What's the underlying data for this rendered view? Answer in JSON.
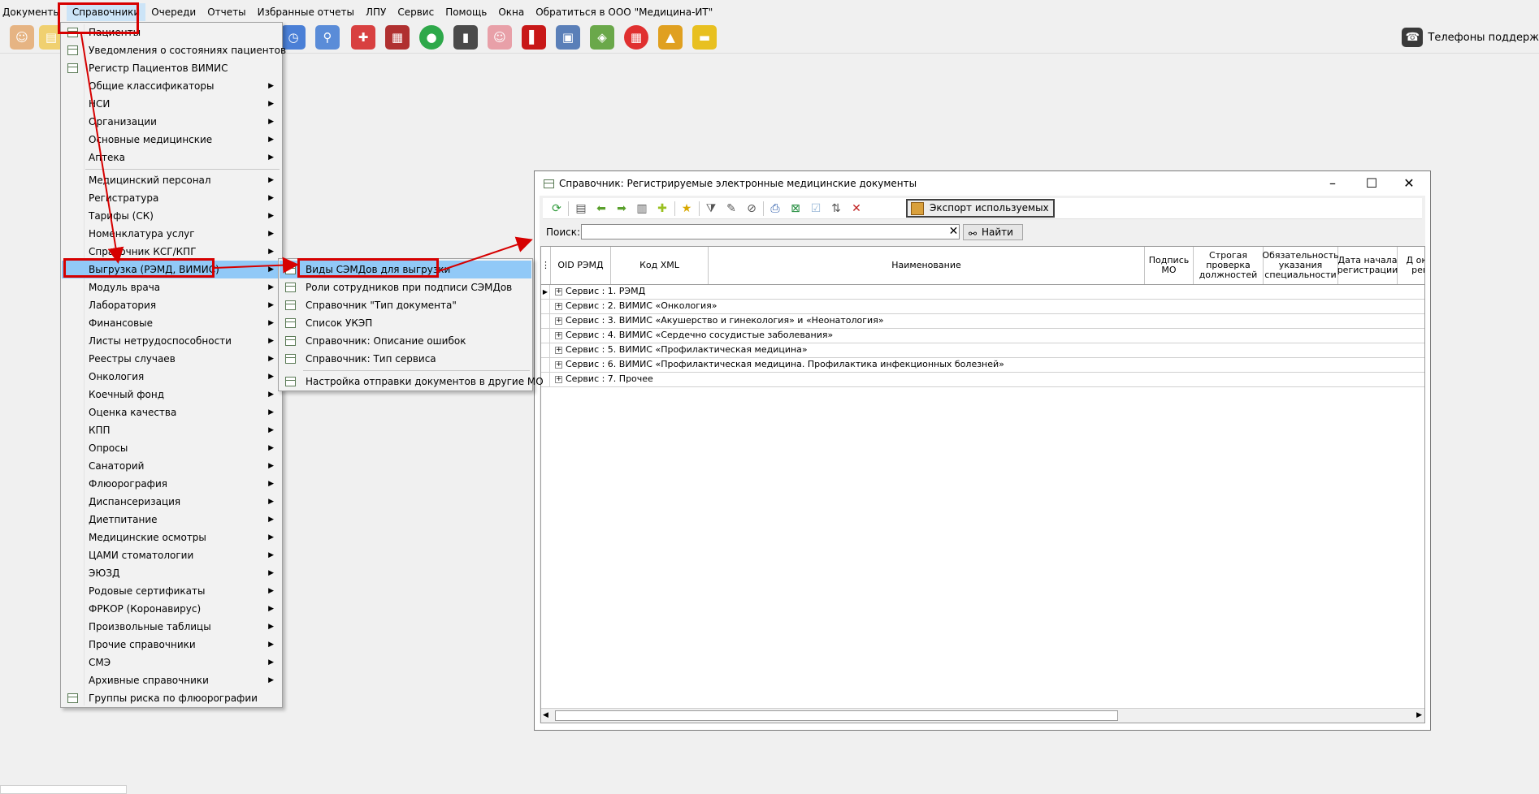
{
  "menubar": [
    "Документы",
    "Справочники",
    "Очереди",
    "Отчеты",
    "Избранные отчеты",
    "ЛПУ",
    "Сервис",
    "Помощь",
    "Окна",
    "Обратиться в ООО \"Медицина-ИТ\""
  ],
  "support_text": "Телефоны поддерж",
  "menu": {
    "items": [
      {
        "label": "Пациенты",
        "icon": true
      },
      {
        "label": "Уведомления о состояниях пациентов",
        "icon": true
      },
      {
        "label": "Регистр Пациентов ВИМИС",
        "icon": true
      },
      {
        "label": "Общие классификаторы",
        "arrow": true
      },
      {
        "label": "НСИ",
        "arrow": true
      },
      {
        "label": "Организации",
        "arrow": true
      },
      {
        "label": "Основные медицинские",
        "arrow": true
      },
      {
        "label": "Аптека",
        "arrow": true
      },
      {
        "label": "Медицинский персонал",
        "arrow": true
      },
      {
        "label": "Регистратура",
        "arrow": true
      },
      {
        "label": "Тарифы (СК)",
        "arrow": true
      },
      {
        "label": "Номенклатура услуг",
        "arrow": true
      },
      {
        "label": "Справочник КСГ/КПГ",
        "arrow": true
      },
      {
        "label": "Выгрузка (РЭМД, ВИМИС)",
        "arrow": true,
        "highlighted": true
      },
      {
        "label": "Модуль врача",
        "arrow": true
      },
      {
        "label": "Лаборатория",
        "arrow": true
      },
      {
        "label": "Финансовые",
        "arrow": true
      },
      {
        "label": "Листы нетрудоспособности",
        "arrow": true
      },
      {
        "label": "Реестры случаев",
        "arrow": true
      },
      {
        "label": "Онкология",
        "arrow": true
      },
      {
        "label": "Коечный фонд",
        "arrow": true
      },
      {
        "label": "Оценка качества",
        "arrow": true
      },
      {
        "label": "КПП",
        "arrow": true
      },
      {
        "label": "Опросы",
        "arrow": true
      },
      {
        "label": "Санаторий",
        "arrow": true
      },
      {
        "label": "Флюорография",
        "arrow": true
      },
      {
        "label": "Диспансеризация",
        "arrow": true
      },
      {
        "label": "Диетпитание",
        "arrow": true
      },
      {
        "label": "Медицинские осмотры",
        "arrow": true
      },
      {
        "label": "ЦАМИ стоматологии",
        "arrow": true
      },
      {
        "label": "ЭЮЗД",
        "arrow": true
      },
      {
        "label": "Родовые сертификаты",
        "arrow": true
      },
      {
        "label": "ФРКОР (Коронавирус)",
        "arrow": true
      },
      {
        "label": "Произвольные таблицы",
        "arrow": true
      },
      {
        "label": "Прочие справочники",
        "arrow": true
      },
      {
        "label": "СМЭ",
        "arrow": true
      },
      {
        "label": "Архивные справочники",
        "arrow": true
      },
      {
        "label": "Группы риска по флюорографии",
        "icon": true
      }
    ]
  },
  "submenu": {
    "items": [
      {
        "label": "Виды СЭМДов для выгрузки",
        "highlighted": true
      },
      {
        "label": "Роли сотрудников при подписи СЭМДов"
      },
      {
        "label": "Справочник \"Тип документа\""
      },
      {
        "label": "Список УКЭП"
      },
      {
        "label": "Справочник: Описание ошибок"
      },
      {
        "label": "Справочник: Тип сервиса"
      },
      {
        "label": "Настройка отправки документов в другие МО"
      }
    ]
  },
  "dialog": {
    "title": "Справочник: Регистрируемые электронные медицинские документы",
    "export_label": "Экспорт используемых",
    "search_label": "Поиск:",
    "search_value": "",
    "find_label": "Найти",
    "columns": [
      "OID РЭМД",
      "Код XML",
      "Наименование",
      "Подпись МО",
      "Строгая проверка должностей",
      "Обязательность указания специальности",
      "Дата начала регистрации",
      "Д оконч регис"
    ],
    "rows": [
      "Сервис : 1. РЭМД",
      "Сервис : 2. ВИМИС «Онкология»",
      "Сервис : 3. ВИМИС «Акушерство и гинекология» и «Неонатология»",
      "Сервис : 4. ВИМИС «Сердечно сосудистые заболевания»",
      "Сервис : 5. ВИМИС «Профилактическая медицина»",
      "Сервис : 6. ВИМИС «Профилактическая медицина. Профилактика инфекционных болезней»",
      "Сервис : 7. Прочее"
    ]
  }
}
